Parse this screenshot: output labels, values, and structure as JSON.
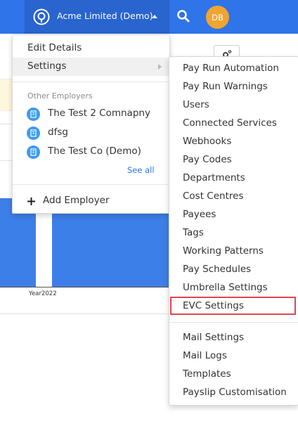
{
  "topbar": {
    "employer_name": "Acme Limited (Demo)",
    "avatar_initials": "DB",
    "brand_color": "#2f74e8"
  },
  "background": {
    "chart_year_label": "Year2022"
  },
  "employer_menu": {
    "items": [
      {
        "label": "Edit Details"
      },
      {
        "label": "Settings"
      }
    ],
    "other_employers_heading": "Other Employers",
    "employers": [
      {
        "label": "The Test 2 Comnapny"
      },
      {
        "label": "dfsg"
      },
      {
        "label": "The Test Co (Demo)"
      }
    ],
    "see_all_label": "See all",
    "add_employer_label": "Add Employer"
  },
  "settings_menu": {
    "group1": [
      {
        "label": "Pay Run Automation"
      },
      {
        "label": "Pay Run Warnings"
      },
      {
        "label": "Users"
      },
      {
        "label": "Connected Services"
      },
      {
        "label": "Webhooks"
      },
      {
        "label": "Pay Codes"
      },
      {
        "label": "Departments"
      },
      {
        "label": "Cost Centres"
      },
      {
        "label": "Payees"
      },
      {
        "label": "Tags"
      },
      {
        "label": "Working Patterns"
      },
      {
        "label": "Pay Schedules"
      },
      {
        "label": "Umbrella Settings"
      },
      {
        "label": "EVC Settings"
      }
    ],
    "group2": [
      {
        "label": "Mail Settings"
      },
      {
        "label": "Mail Logs"
      },
      {
        "label": "Templates"
      },
      {
        "label": "Payslip Customisation"
      }
    ],
    "highlighted_item": "EVC Settings",
    "highlight_color": "#e0454d"
  }
}
